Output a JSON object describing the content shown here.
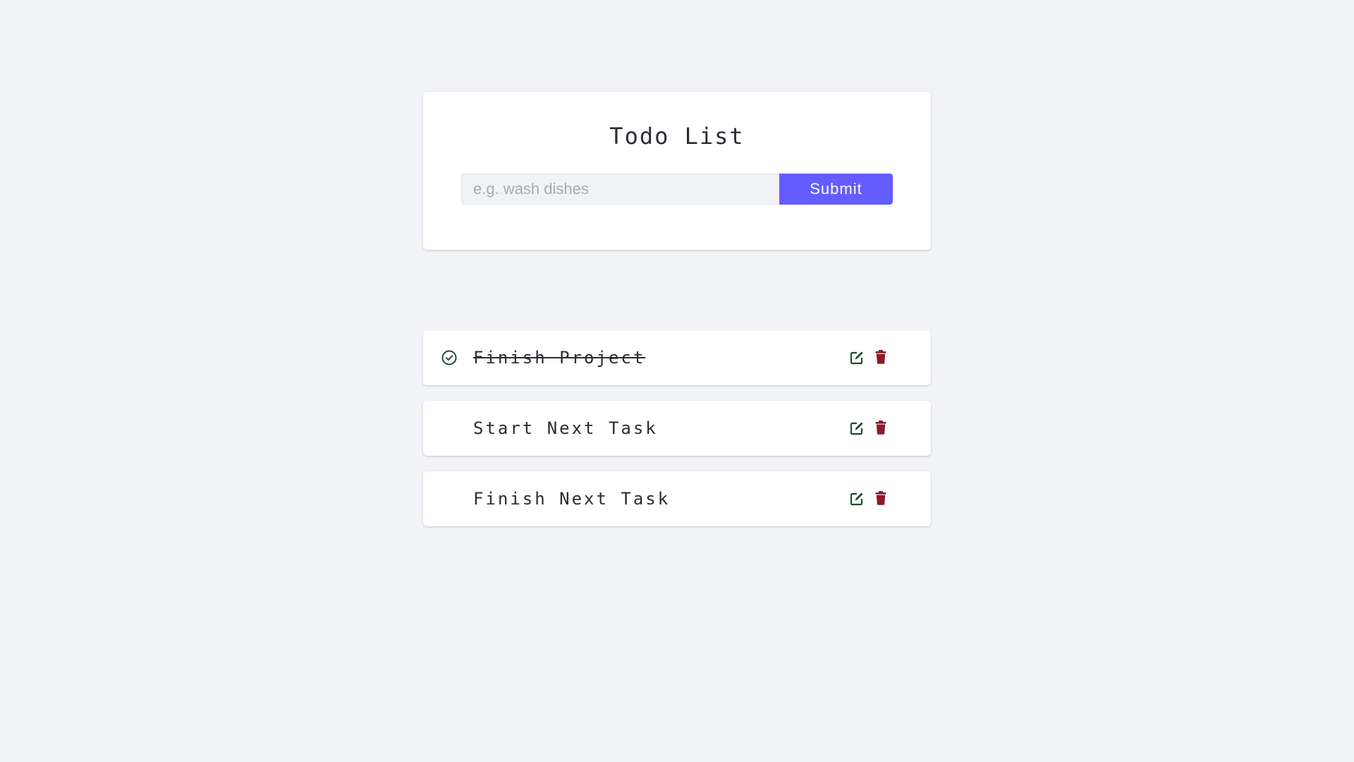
{
  "form": {
    "title": "Todo List",
    "input_placeholder": "e.g. wash dishes",
    "input_value": "",
    "submit_label": "Submit"
  },
  "todos": [
    {
      "text": "Finish Project",
      "completed": true
    },
    {
      "text": "Start Next Task",
      "completed": false
    },
    {
      "text": "Finish Next Task",
      "completed": false
    }
  ],
  "icons": {
    "complete": "check-circle-icon",
    "edit": "edit-icon",
    "delete": "trash-icon"
  },
  "colors": {
    "background": "#f2f3f7",
    "primary": "#645cff",
    "edit_icon": "#1e4d33",
    "delete_icon": "#8b1a2b",
    "check_icon": "#1e4d33"
  }
}
